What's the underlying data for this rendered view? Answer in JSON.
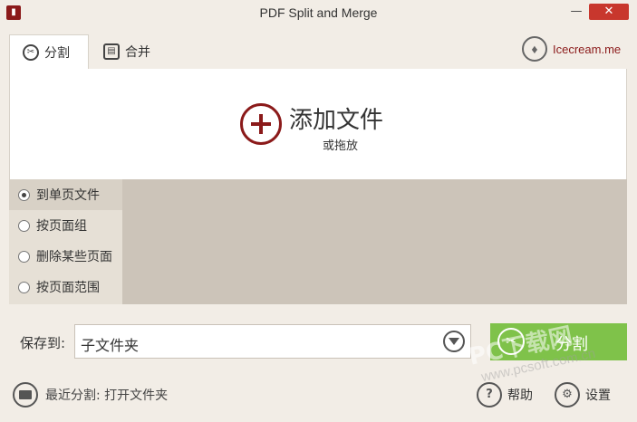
{
  "window": {
    "title": "PDF Split and Merge",
    "minimize": "—",
    "close": "✕"
  },
  "tabs": [
    {
      "label": "分割",
      "icon": "scissors-icon",
      "active": true
    },
    {
      "label": "合并",
      "icon": "document-icon",
      "active": false
    }
  ],
  "brand": {
    "label": "Icecream.me",
    "icon": "icecream-logo-icon"
  },
  "drop_zone": {
    "title": "添加文件",
    "subtitle": "或拖放"
  },
  "split_options": [
    {
      "label": "到单页文件",
      "selected": true
    },
    {
      "label": "按页面组",
      "selected": false
    },
    {
      "label": "删除某些页面",
      "selected": false
    },
    {
      "label": "按页面范围",
      "selected": false
    }
  ],
  "save": {
    "label": "保存到:",
    "value": "子文件夹"
  },
  "split_button": {
    "label": "分割",
    "color": "#7fc24a"
  },
  "recent": {
    "label": "最近分割: 打开文件夹"
  },
  "help": {
    "label": "帮助",
    "icon_glyph": "?"
  },
  "settings": {
    "label": "设置",
    "icon_glyph": "⚙"
  },
  "watermark": {
    "text": "PC下载网",
    "url": "www.pcsoft.com.cn"
  },
  "colors": {
    "accent": "#8b1a1a",
    "button": "#7fc24a",
    "background": "#f2ede6"
  }
}
